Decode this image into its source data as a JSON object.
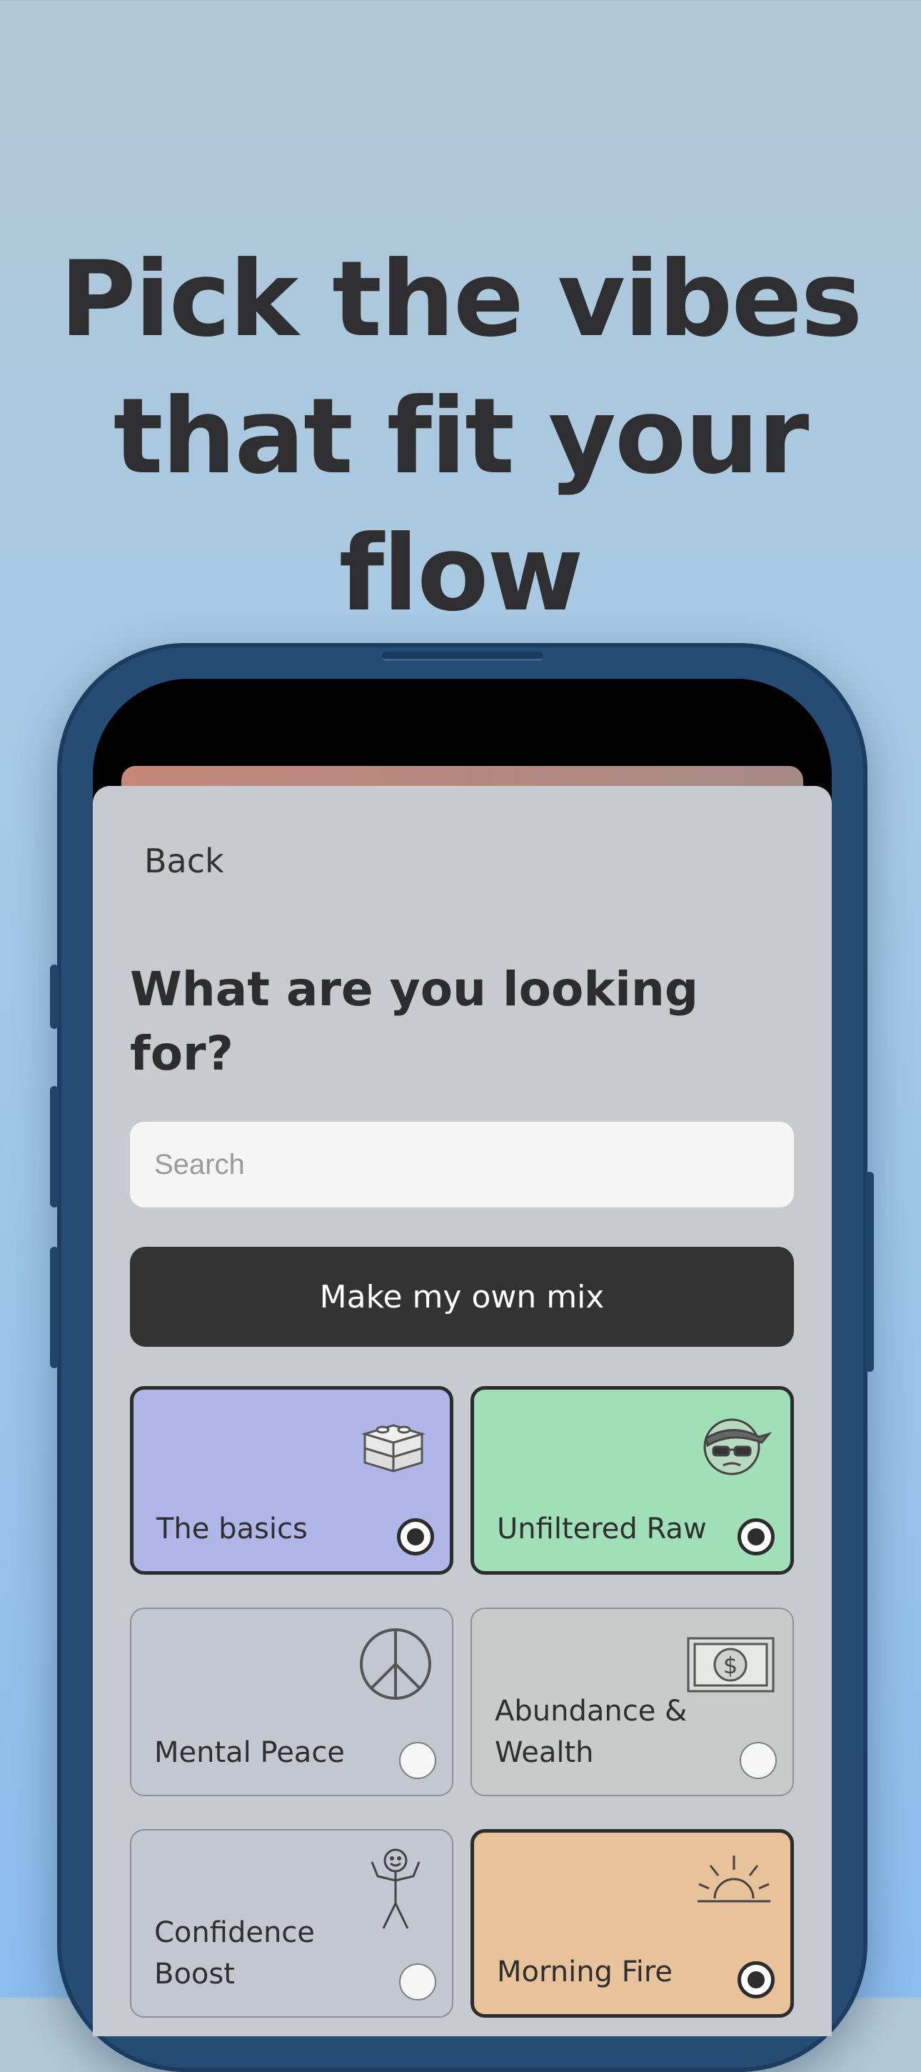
{
  "headline": {
    "line1": "Pick the vibes",
    "line2": "that fit your",
    "line3": "flow"
  },
  "sheet": {
    "back_label": "Back",
    "question": "What are you looking for?",
    "search_placeholder": "Search",
    "mix_button_label": "Make my own mix"
  },
  "categories": [
    {
      "label": "The basics",
      "selected": true,
      "color": "#b0b6e7",
      "icon": "blocks-icon"
    },
    {
      "label": "Unfiltered Raw",
      "selected": true,
      "color": "#a0dfb8",
      "icon": "bandana-face-icon"
    },
    {
      "label": "Mental Peace",
      "selected": false,
      "color": "#c3c8d0",
      "icon": "peace-sign-icon"
    },
    {
      "label": "Abundance & Wealth",
      "selected": false,
      "color": "#c8cbc9",
      "icon": "dollar-bill-icon"
    },
    {
      "label": "Confidence Boost",
      "selected": false,
      "color": "#c3c8d0",
      "icon": "stick-figure-icon"
    },
    {
      "label": "Morning Fire",
      "selected": true,
      "color": "#e7c29b",
      "icon": "sunrise-icon"
    }
  ],
  "colors": {
    "background_top": "#b1c8d6",
    "background_bottom": "#8cbdee",
    "phone_frame": "#244c75",
    "sheet": "#c7cbcf",
    "button_dark": "#333333"
  }
}
